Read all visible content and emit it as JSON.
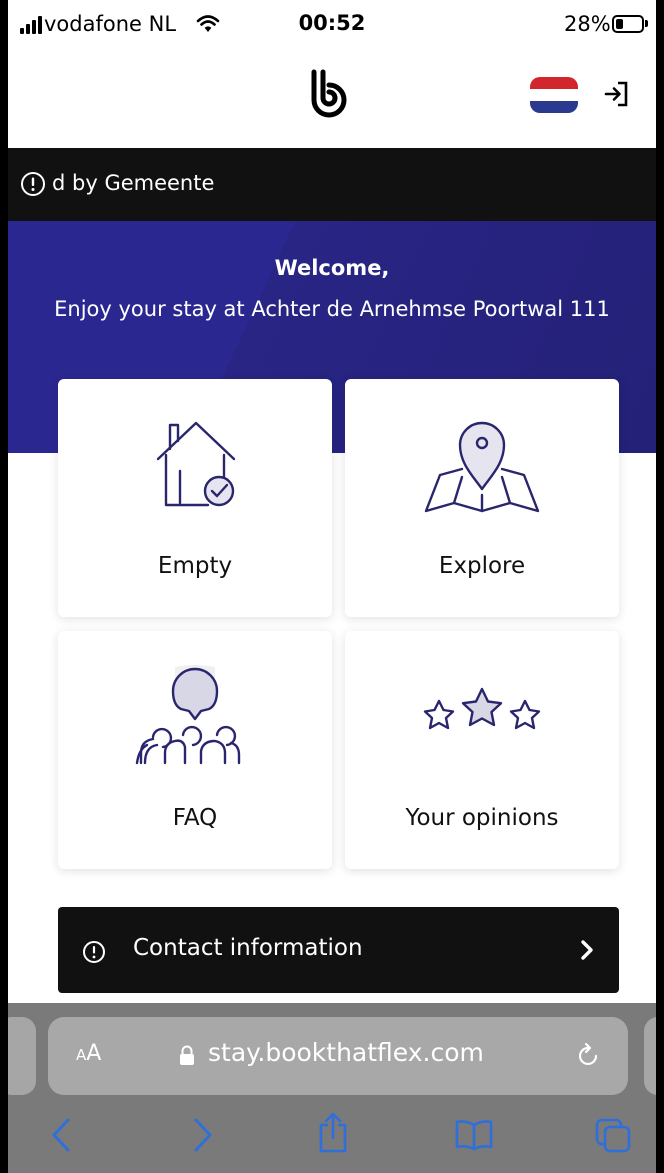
{
  "status_bar": {
    "carrier": "vodafone NL",
    "time": "00:52",
    "battery_percent": "28%",
    "battery_level": 0.28,
    "signal_bars": 4
  },
  "header": {
    "logo_icon": "bookthatflex-logo",
    "language_flag": "netherlands-flag",
    "login_icon": "login-arrow-icon"
  },
  "notice": {
    "text": "d by Gemeente",
    "icon": "info-circle-icon"
  },
  "hero": {
    "title": "Welcome,",
    "subtitle": "Enjoy your stay at Achter de Arnehmse Poortwal 111"
  },
  "tiles": [
    {
      "label": "Empty",
      "icon": "house-check-icon"
    },
    {
      "label": "Explore",
      "icon": "map-pin-icon"
    },
    {
      "label": "FAQ",
      "icon": "people-chat-icon"
    },
    {
      "label": "Your opinions",
      "icon": "three-stars-icon"
    }
  ],
  "contact": {
    "label": "Contact information",
    "icon": "info-circle-icon",
    "chevron": "chevron-right-icon"
  },
  "browser": {
    "text_size_label": "AA",
    "url": "stay.bookthatflex.com",
    "toolbar": [
      "back-icon",
      "forward-icon",
      "share-icon",
      "bookmarks-icon",
      "tabs-icon"
    ]
  },
  "colors": {
    "brand_navy": "#2a2890",
    "dark_bar": "#111111",
    "icon_stroke": "#29266e"
  }
}
